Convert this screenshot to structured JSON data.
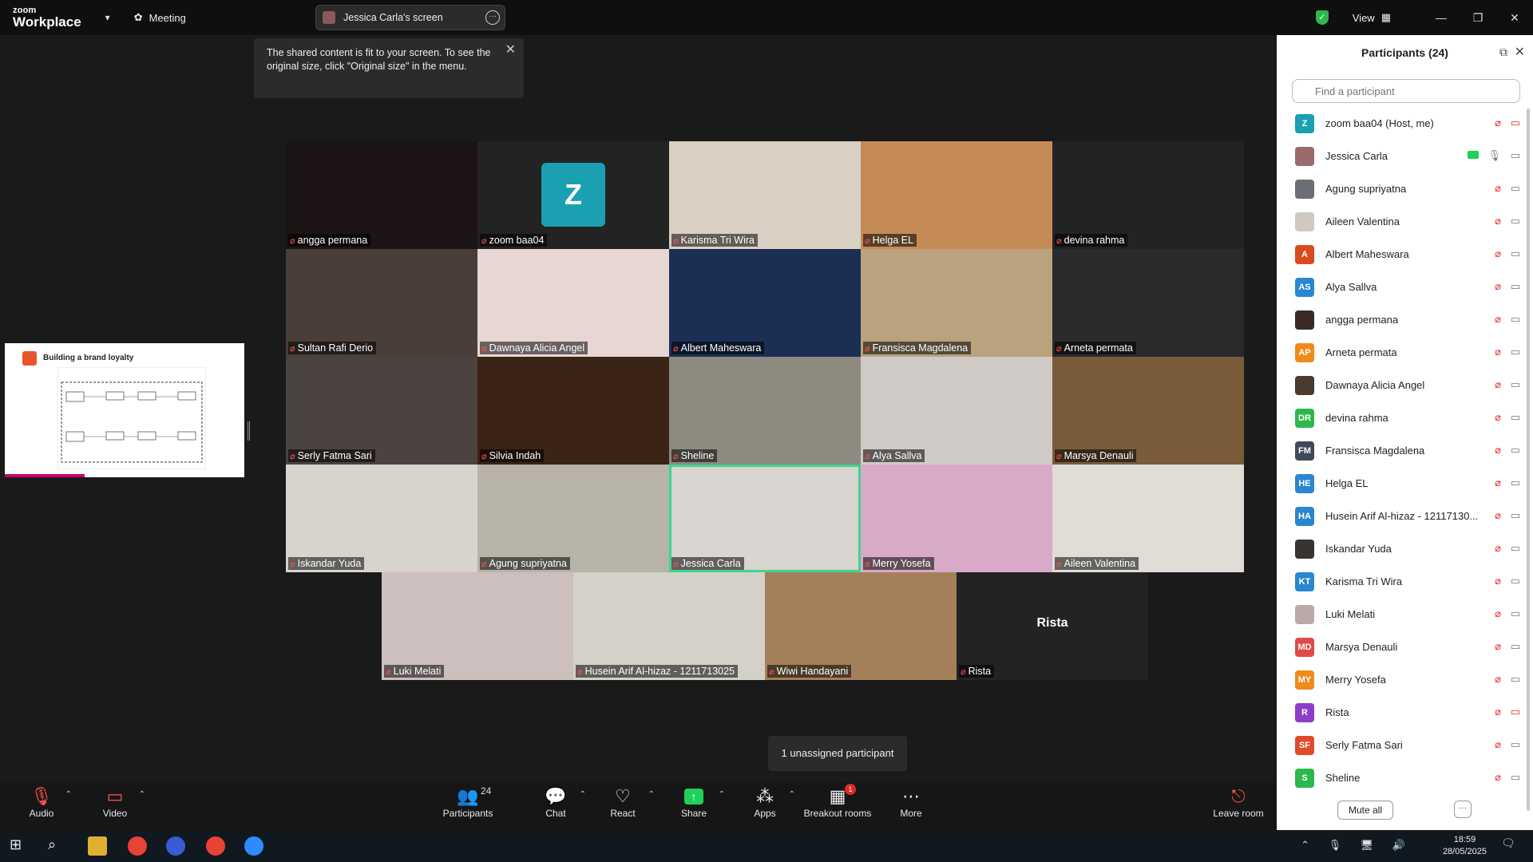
{
  "titlebar": {
    "logo_line1": "zoom",
    "logo_line2": "Workplace",
    "meeting_label": "Meeting",
    "share_pill": "Jessica Carla's screen",
    "view_label": "View"
  },
  "tooltip": {
    "text": "The shared content is fit to your screen. To see the original size, click \"Original size\" in the menu."
  },
  "slide": {
    "title": "Building a brand loyalty"
  },
  "gallery": {
    "tiles": [
      {
        "name": "angga permana",
        "color": "#1c1414"
      },
      {
        "name": "zoom baa04",
        "color": "#232323"
      },
      {
        "name": "Karisma Tri Wira",
        "color": "#d9cfc3"
      },
      {
        "name": "Helga EL",
        "color": "#c58b57"
      },
      {
        "name": "devina rahma",
        "color": "#232323"
      },
      {
        "name": "Sultan Rafi Derio",
        "color": "#4a3f38"
      },
      {
        "name": "Dawnaya Alicia Angel",
        "color": "#e8d6d4"
      },
      {
        "name": "Albert Maheswara",
        "color": "#1b2f55"
      },
      {
        "name": "Fransisca Magdalena",
        "color": "#b9a27d"
      },
      {
        "name": "Arneta permata",
        "color": "#2a2a2a"
      },
      {
        "name": "Serly Fatma Sari",
        "color": "#4b4340"
      },
      {
        "name": "Silvia Indah",
        "color": "#3a2416"
      },
      {
        "name": "Sheline",
        "color": "#8d8a80"
      },
      {
        "name": "Alya Sallva",
        "color": "#cfcac6"
      },
      {
        "name": "Marsya Denauli",
        "color": "#7a5b3a"
      },
      {
        "name": "Iskandar Yuda",
        "color": "#d8d4cd"
      },
      {
        "name": "Agung supriyatna",
        "color": "#b7b3a8"
      },
      {
        "name": "Jessica Carla",
        "color": "#d9d5d0"
      },
      {
        "name": "Merry Yosefa",
        "color": "#d9aac8"
      },
      {
        "name": "Aileen Valentina",
        "color": "#e0dcd6"
      },
      {
        "name": "Luki Melati",
        "color": "#cdbfbd"
      },
      {
        "name": "Husein Arif Al-hizaz - 1211713025",
        "color": "#d4d1c9"
      },
      {
        "name": "Wiwi Handayani",
        "color": "#a4805a"
      },
      {
        "name": "Rista",
        "color": "#232323"
      }
    ],
    "zoom_avatar": "Z",
    "rista_center": "Rista"
  },
  "unassigned": "1 unassigned participant",
  "toolbar": {
    "audio": "Audio",
    "video": "Video",
    "participants": "Participants",
    "participants_count": "24",
    "chat": "Chat",
    "react": "React",
    "share": "Share",
    "apps": "Apps",
    "breakout": "Breakout rooms",
    "breakout_badge": "1",
    "more": "More",
    "leave": "Leave room"
  },
  "panel": {
    "title": "Participants (24)",
    "search_placeholder": "Find a participant",
    "participants": [
      {
        "initials": "Z",
        "name": "zoom baa04 (Host, me)",
        "color": "#1aa0b0",
        "cam_off": true
      },
      {
        "initials": "",
        "name": "Jessica Carla",
        "color": "#9b6a6a",
        "sharing": true
      },
      {
        "initials": "",
        "name": "Agung supriyatna",
        "color": "#6b6e75"
      },
      {
        "initials": "",
        "name": "Aileen Valentina",
        "color": "#d0c9c2"
      },
      {
        "initials": "A",
        "name": "Albert Maheswara",
        "color": "#d94a1e"
      },
      {
        "initials": "AS",
        "name": "Alya Sallva",
        "color": "#2a86d1"
      },
      {
        "initials": "",
        "name": "angga permana",
        "color": "#3a2a2a"
      },
      {
        "initials": "AP",
        "name": "Arneta permata",
        "color": "#f08a1c"
      },
      {
        "initials": "",
        "name": "Dawnaya Alicia Angel",
        "color": "#4a3a30"
      },
      {
        "initials": "DR",
        "name": "devina rahma",
        "color": "#2db84b"
      },
      {
        "initials": "FM",
        "name": "Fransisca Magdalena",
        "color": "#3d4a5c"
      },
      {
        "initials": "HE",
        "name": "Helga EL",
        "color": "#2a86d1"
      },
      {
        "initials": "HA",
        "name": "Husein Arif Al-hizaz - 12117130...",
        "color": "#2a86d1"
      },
      {
        "initials": "",
        "name": "Iskandar Yuda",
        "color": "#3a3430"
      },
      {
        "initials": "KT",
        "name": "Karisma Tri Wira",
        "color": "#2a86d1"
      },
      {
        "initials": "",
        "name": "Luki Melati",
        "color": "#b9aaa5"
      },
      {
        "initials": "MD",
        "name": "Marsya Denauli",
        "color": "#e04a4a"
      },
      {
        "initials": "MY",
        "name": "Merry Yosefa",
        "color": "#f08a1c"
      },
      {
        "initials": "R",
        "name": "Rista",
        "color": "#8a3fc6",
        "cam_off": true
      },
      {
        "initials": "SF",
        "name": "Serly Fatma Sari",
        "color": "#e04a2a"
      },
      {
        "initials": "S",
        "name": "Sheline",
        "color": "#2db84b"
      }
    ],
    "mute_all": "Mute all"
  },
  "taskbar": {
    "time": "18:59",
    "date": "28/05/2025"
  }
}
